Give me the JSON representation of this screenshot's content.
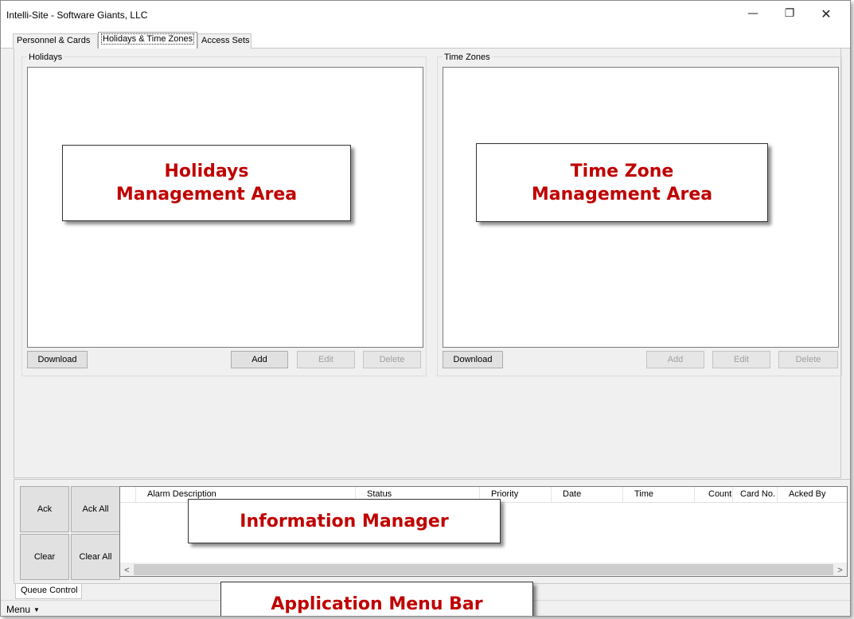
{
  "window": {
    "title": "Intelli-Site - Software Giants, LLC",
    "controls": {
      "minimize": "—",
      "restore": "❐",
      "close": "✕"
    }
  },
  "tabs": [
    {
      "label": "Personnel & Cards",
      "active": false
    },
    {
      "label": "Holidays & Time Zones",
      "active": true
    },
    {
      "label": "Access Sets",
      "active": false
    }
  ],
  "holidays": {
    "label": "Holidays",
    "buttons": {
      "download": "Download",
      "add": "Add",
      "edit": "Edit",
      "delete": "Delete"
    },
    "callout_line1": "Holidays",
    "callout_line2": "Management Area"
  },
  "time_zones": {
    "label": "Time Zones",
    "buttons": {
      "download": "Download",
      "add": "Add",
      "edit": "Edit",
      "delete": "Delete"
    },
    "callout_line1": "Time Zone",
    "callout_line2": "Management Area"
  },
  "queue": {
    "buttons": {
      "ack": "Ack",
      "ack_all": "Ack All",
      "clear": "Clear",
      "clear_all": "Clear All"
    },
    "columns": [
      "Alarm Description",
      "Status",
      "Priority",
      "Date",
      "Time",
      "Count",
      "Card No.",
      "Acked By"
    ],
    "callout": "Information Manager",
    "scroll_left": "<",
    "scroll_right": ">"
  },
  "bottom_tab": "Queue Control",
  "menu": {
    "label": "Menu",
    "caret": "▼"
  },
  "menu_callout": "Application Menu Bar",
  "colors": {
    "callout_text": "#c00000",
    "window_bg": "#f0f0f0"
  }
}
